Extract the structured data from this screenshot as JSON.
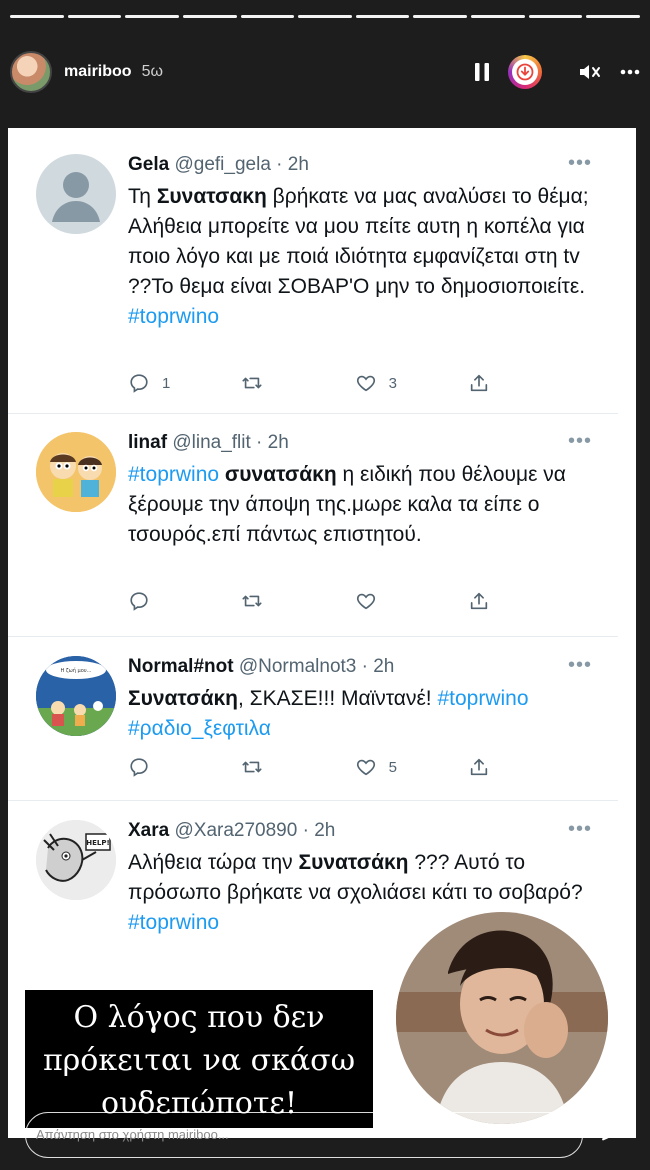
{
  "story": {
    "username": "mairiboo",
    "time": "5ω",
    "progress_segments": 11
  },
  "tweets": [
    {
      "name": "Gela",
      "handle": "@gefi_gela · 2h",
      "text_before": "Τη ",
      "text_bold": "Συνατσακη",
      "text_after": " βρήκατε να μας αναλύσει το θέμα; Αλήθεια μπορείτε να μου πείτε αυτη η κοπέλα για ποιο λόγο και με ποιά ιδιότητα εμφανίζεται στη tv ??Το θεμα είναι ΣΟΒΑΡ'Ο μην το δημοσιοποιείτε.",
      "hashtag": "#toprwino",
      "reply_count": "1",
      "retweet_count": "",
      "like_count": "3"
    },
    {
      "name": "linaf",
      "handle": "@lina_flit · 2h",
      "hashtag": "#toprwino",
      "text_bold": "συνατσάκη",
      "text_after": "  η ειδική που θέλουμε να ξέρουμε την άποψη της.μωρε καλα τα είπε ο τσουρός.επί πάντως επιστητού.",
      "reply_count": "",
      "retweet_count": "",
      "like_count": ""
    },
    {
      "name": "Normal#not",
      "handle": "@Normalnot3 · 2h",
      "text_bold": "Συνατσάκη",
      "text_after": ", ΣΚΑΣΕ!!! Μαϊντανέ! ",
      "hashtag": "#toprwino",
      "hashtag2": "#ραδιο_ξεφτιλα",
      "reply_count": "",
      "retweet_count": "",
      "like_count": "5",
      "avatar_text": "Η ζωή μου..."
    },
    {
      "name": "Xara",
      "handle": "@Xara270890 · 2h",
      "text_before": "Αλήθεια τώρα την ",
      "text_bold": "Συνατσάκη",
      "text_after": " ??? Αυτό το πρόσωπο βρήκατε να σχολιάσει κάτι το σοβαρό?",
      "hashtag": "#toprwino",
      "avatar_text": "HELP!"
    }
  ],
  "caption": {
    "line1": "Ο λόγος που δεν",
    "line2": "πρόκειται να σκάσω",
    "line3": "ουδεπώποτε!"
  },
  "reply_bar": {
    "placeholder": "Απάντηση στο χρήστη mairiboo..."
  },
  "icons": {
    "pause": "pause-icon",
    "download": "download-icon",
    "mute": "mute-icon",
    "more": "more-icon",
    "send": "send-icon"
  },
  "colors": {
    "hashtag": "#1d9bf0",
    "story_bg": "#1d1d1d"
  }
}
